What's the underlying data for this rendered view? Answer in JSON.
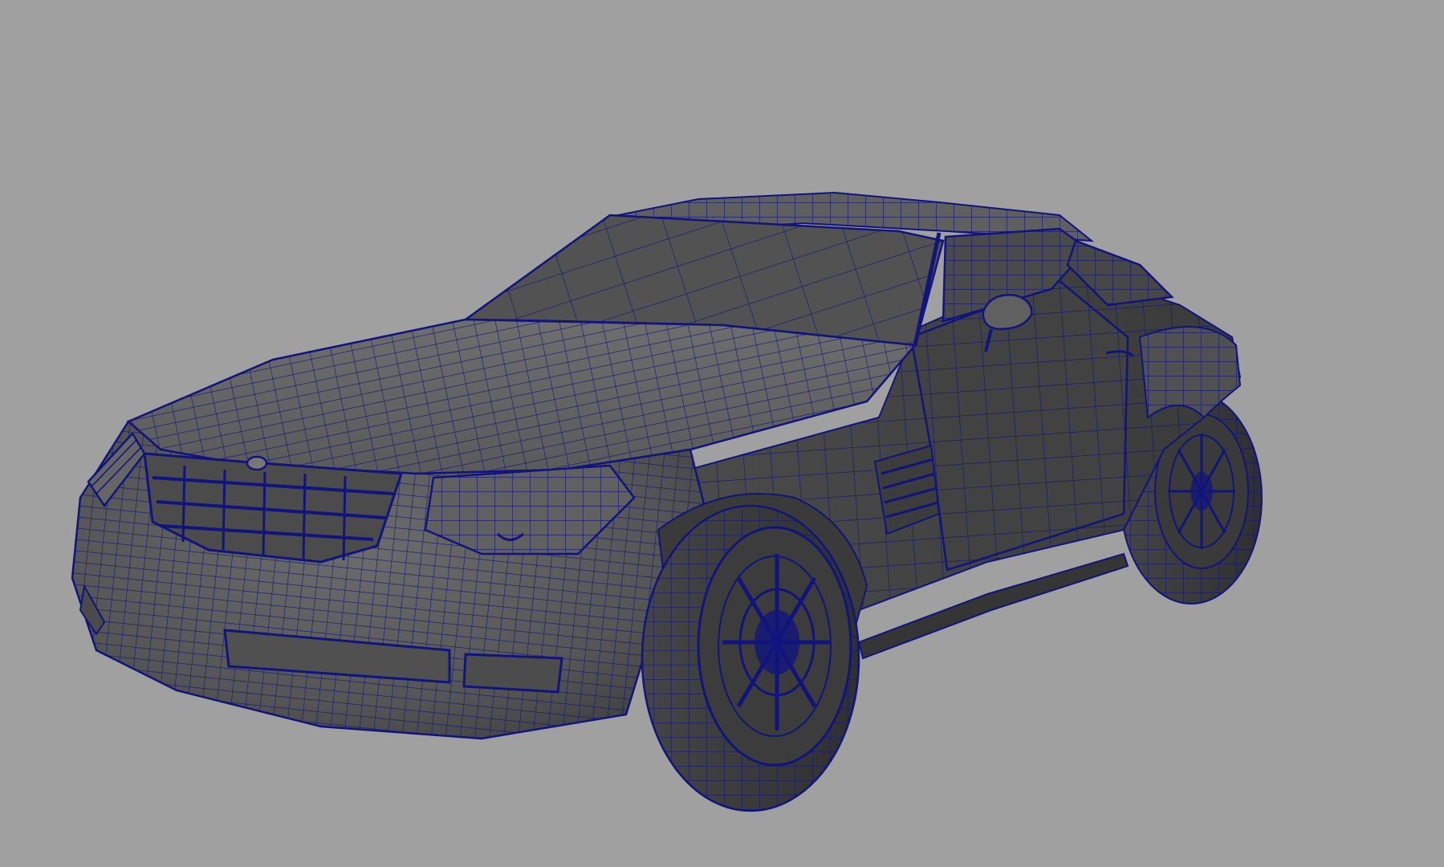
{
  "viewport": {
    "background_color": "#a0a0a0",
    "shading": "wireframe-on-shaded",
    "wire_color": "#0f137a",
    "surface_color": "#5a5a5a",
    "surface_dark_color": "#3e3e3e",
    "surface_light_color": "#737373"
  },
  "model": {
    "object": "car",
    "parts": [
      "body",
      "hood",
      "windshield",
      "roof",
      "side-window",
      "door",
      "side-mirror",
      "front-grille",
      "headlight-left",
      "headlight-right",
      "front-bumper",
      "front-wheel",
      "rear-wheel",
      "side-vent"
    ]
  }
}
